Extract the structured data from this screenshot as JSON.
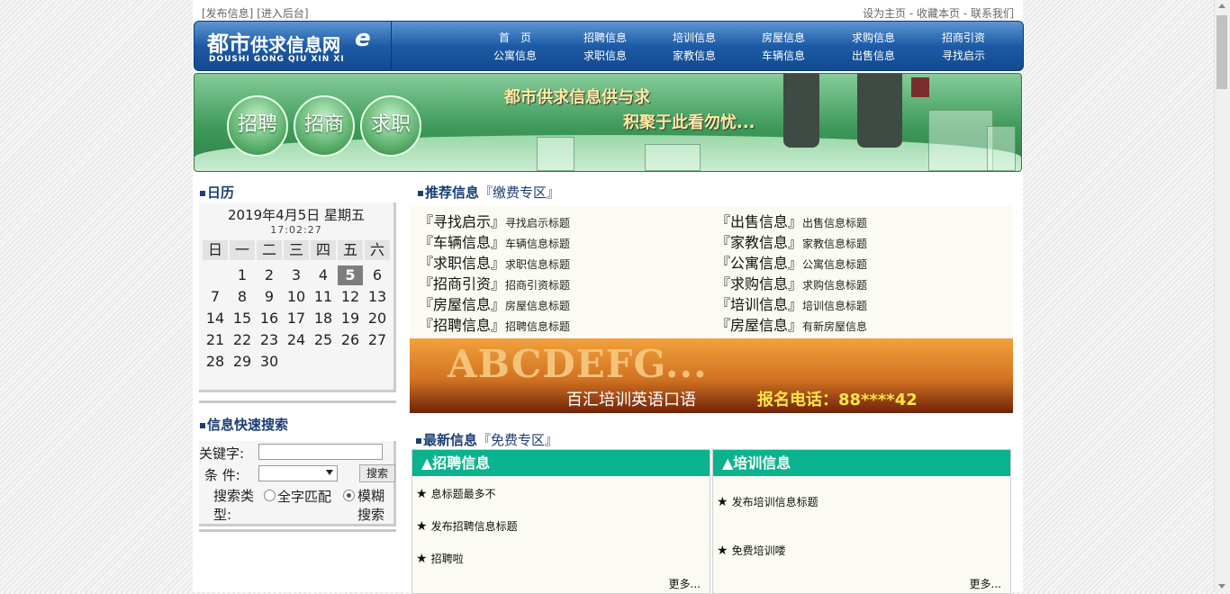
{
  "topbar": {
    "post": "[发布信息]",
    "admin": "[进入后台]",
    "right": "设为主页 - 收藏本页 - 联系我们"
  },
  "logo": {
    "cn_main": "都市",
    "cn_rest": "供求信息网",
    "en": "DOUSHI  GONG QIU XIN XI",
    "mark": "e"
  },
  "nav": [
    {
      "label": "首　页"
    },
    {
      "label": "招聘信息"
    },
    {
      "label": "培训信息"
    },
    {
      "label": "房屋信息"
    },
    {
      "label": "求购信息"
    },
    {
      "label": "招商引资"
    },
    {
      "label": "公寓信息"
    },
    {
      "label": "求职信息"
    },
    {
      "label": "家教信息"
    },
    {
      "label": "车辆信息"
    },
    {
      "label": "出售信息"
    },
    {
      "label": "寻找启示"
    }
  ],
  "banner": {
    "b1": "招聘",
    "b2": "招商",
    "b3": "求职",
    "slogan1": "都市供求信息供与求",
    "slogan2": "积聚于此看勿忧..."
  },
  "calendar": {
    "title": "日历",
    "date": "2019年4月5日 星期五",
    "time": "17:02:27",
    "weekdays": [
      "日",
      "一",
      "二",
      "三",
      "四",
      "五",
      "六"
    ],
    "today": "5",
    "days": [
      "",
      "1",
      "2",
      "3",
      "4",
      "5",
      "6",
      "7",
      "8",
      "9",
      "10",
      "11",
      "12",
      "13",
      "14",
      "15",
      "16",
      "17",
      "18",
      "19",
      "20",
      "21",
      "22",
      "23",
      "24",
      "25",
      "26",
      "27",
      "28",
      "29",
      "30"
    ]
  },
  "search": {
    "title": "信息快速搜索",
    "keyword_label": "关键字:",
    "cond_label": "条  件:",
    "button": "搜索",
    "type_label": "搜索类型:",
    "opt1": "全字匹配",
    "opt2": "模糊搜索",
    "keyword_value": ""
  },
  "recommend": {
    "title": "推荐信息",
    "sub": "『缴费专区』",
    "left": [
      {
        "cat": "『寻找启示』",
        "desc": "寻找启示标题"
      },
      {
        "cat": "『车辆信息』",
        "desc": "车辆信息标题"
      },
      {
        "cat": "『求职信息』",
        "desc": "求职信息标题"
      },
      {
        "cat": "『招商引资』",
        "desc": "招商引资标题"
      },
      {
        "cat": "『房屋信息』",
        "desc": "房屋信息标题"
      },
      {
        "cat": "『招聘信息』",
        "desc": "招聘信息标题"
      }
    ],
    "right": [
      {
        "cat": "『出售信息』",
        "desc": "出售信息标题"
      },
      {
        "cat": "『家教信息』",
        "desc": "家教信息标题"
      },
      {
        "cat": "『公寓信息』",
        "desc": "公寓信息标题"
      },
      {
        "cat": "『求购信息』",
        "desc": "求购信息标题"
      },
      {
        "cat": "『培训信息』",
        "desc": "培训信息标题"
      },
      {
        "cat": "『房屋信息』",
        "desc": "有新房屋信息"
      }
    ]
  },
  "ad": {
    "big": "ABCDEFG...",
    "t1": "百汇培训英语口语",
    "t2": "报名电话：88****42"
  },
  "latest": {
    "title": "最新信息",
    "sub": "『免费专区』",
    "recruit": {
      "head": "▲招聘信息",
      "items": [
        "息标题最多不",
        "发布招聘信息标题",
        "招聘啦"
      ],
      "more": "更多..."
    },
    "training": {
      "head": "▲培训信息",
      "items": [
        "发布培训信息标题",
        "免费培训喽"
      ],
      "more": "更多..."
    }
  }
}
